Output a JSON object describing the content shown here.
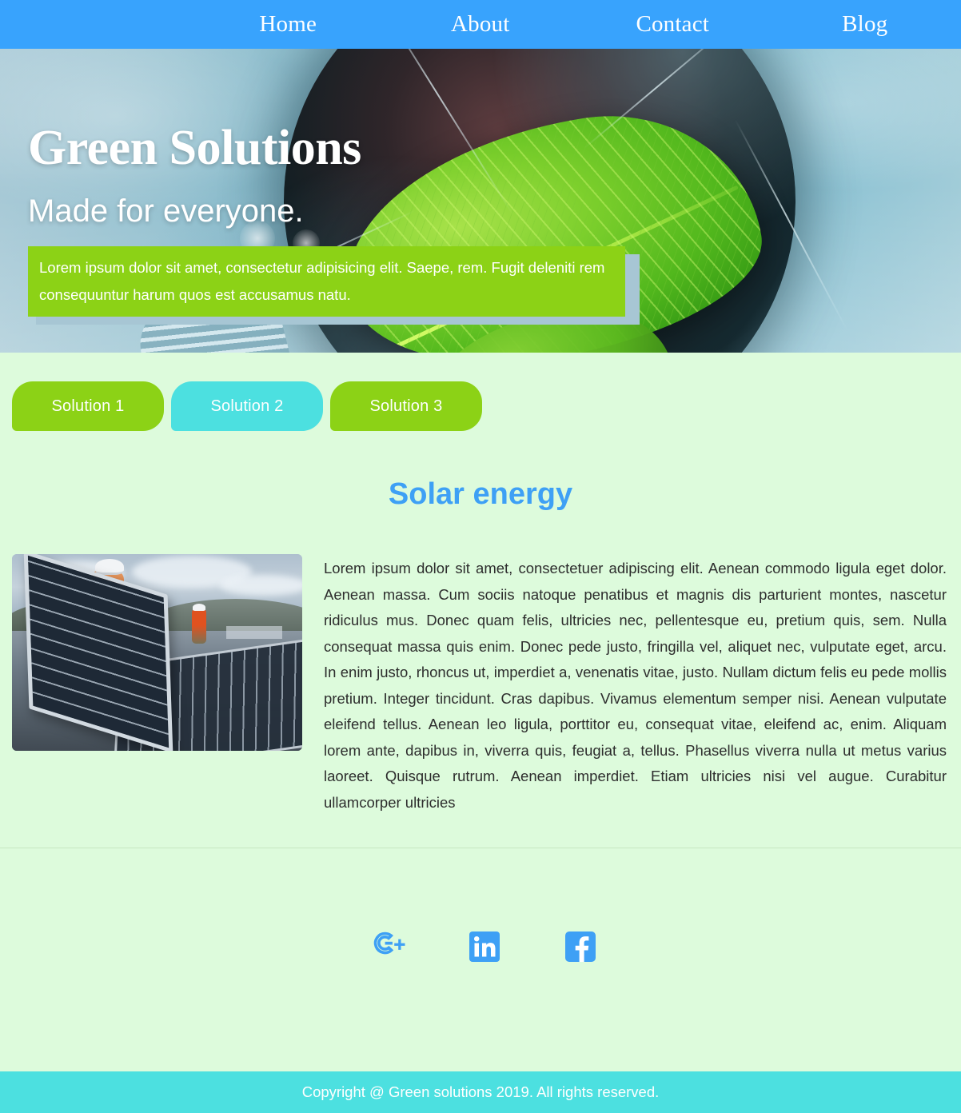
{
  "colors": {
    "nav_blue": "#38a3fd",
    "accent_green": "#8cd216",
    "accent_cyan": "#4ce0e0",
    "page_bg": "#ddfbdc",
    "heading_blue": "#3ea0f5",
    "social_blue": "#3ea0f5"
  },
  "nav": {
    "items": [
      {
        "label": "Home"
      },
      {
        "label": "About"
      },
      {
        "label": "Contact"
      },
      {
        "label": "Blog"
      }
    ]
  },
  "hero": {
    "title": "Green Solutions",
    "subtitle": "Made for everyone.",
    "note": "Lorem ipsum dolor sit amet, consectetur adipisicing elit. Saepe, rem. Fugit deleniti rem consequuntur harum quos est accusamus natu.",
    "image_alt": "green-leaf-inside-lightbulb"
  },
  "tabs": [
    {
      "label": "Solution 1",
      "state": "inactive",
      "color": "#8cd216"
    },
    {
      "label": "Solution 2",
      "state": "active",
      "color": "#4ce0e0"
    },
    {
      "label": "Solution 3",
      "state": "inactive",
      "color": "#8cd216"
    }
  ],
  "section": {
    "title": "Solar energy",
    "image_alt": "solar-panel-installation-photo",
    "body": "Lorem ipsum dolor sit amet, consectetuer adipiscing elit. Aenean commodo ligula eget dolor. Aenean massa. Cum sociis natoque penatibus et magnis dis parturient montes, nascetur ridiculus mus. Donec quam felis, ultricies nec, pellentesque eu, pretium quis, sem. Nulla consequat massa quis enim. Donec pede justo, fringilla vel, aliquet nec, vulputate eget, arcu. In enim justo, rhoncus ut, imperdiet a, venenatis vitae, justo. Nullam dictum felis eu pede mollis pretium. Integer tincidunt. Cras dapibus. Vivamus elementum semper nisi. Aenean vulputate eleifend tellus. Aenean leo ligula, porttitor eu, consequat vitae, eleifend ac, enim. Aliquam lorem ante, dapibus in, viverra quis, feugiat a, tellus. Phasellus viverra nulla ut metus varius laoreet. Quisque rutrum. Aenean imperdiet. Etiam ultricies nisi vel augue. Curabitur ullamcorper ultricies"
  },
  "social": [
    {
      "name": "google-plus",
      "label": "Google Plus"
    },
    {
      "name": "linkedin",
      "label": "LinkedIn"
    },
    {
      "name": "facebook",
      "label": "Facebook"
    }
  ],
  "footer": {
    "copyright": "Copyright @ Green solutions 2019. All rights reserved."
  }
}
